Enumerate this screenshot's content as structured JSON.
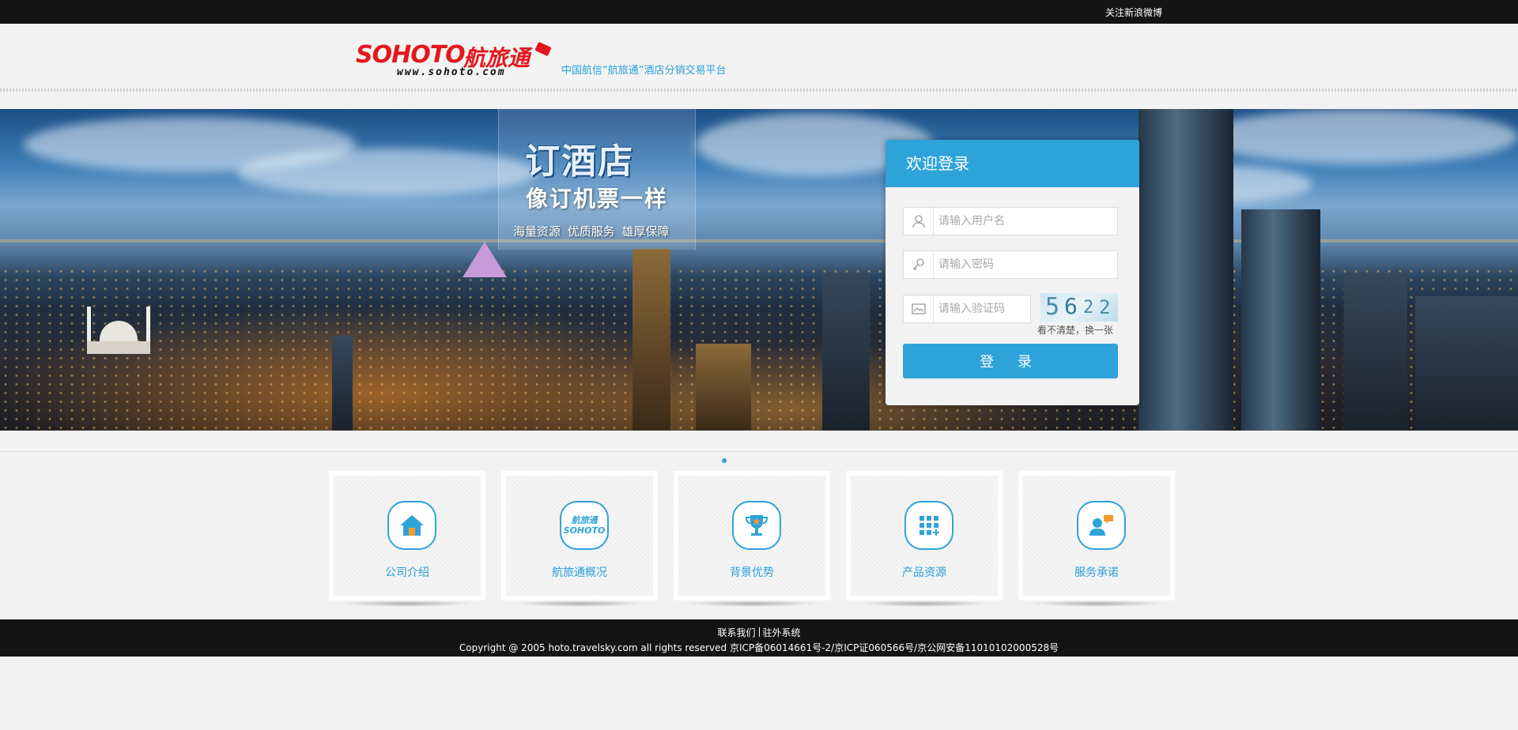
{
  "topbar": {
    "weibo_link": "关注新浪微博"
  },
  "header": {
    "logo_brand": "SOHOTO",
    "logo_brand_cn": "航旅通",
    "logo_url": "www.sohoto.com",
    "tagline": "中国航信“航旅通”酒店分销交易平台"
  },
  "banner": {
    "slogan_main": "订酒店",
    "slogan_sub": "像订机票一样",
    "slogan_features": "海量资源  优质服务  雄厚保障"
  },
  "login": {
    "title": "欢迎登录",
    "username_placeholder": "请输入用户名",
    "password_placeholder": "请输入密码",
    "captcha_placeholder": "请输入验证码",
    "captcha_chars": [
      "5",
      "6",
      "2",
      "2"
    ],
    "captcha_refresh": "看不清楚，换一张",
    "submit_label": "登 录"
  },
  "cards": [
    {
      "label": "公司介绍",
      "icon": "home-icon"
    },
    {
      "label": "航旅通概况",
      "icon": "sohoto-logo-icon",
      "icon_text_cn": "航旅通",
      "icon_text_en": "SOHOTO"
    },
    {
      "label": "背景优势",
      "icon": "trophy-icon"
    },
    {
      "label": "产品资源",
      "icon": "grid-icon"
    },
    {
      "label": "服务承诺",
      "icon": "support-chat-icon"
    }
  ],
  "footer": {
    "contact_link": "联系我们",
    "agency_link": "驻外系统",
    "copyright": "Copyright @ 2005 hoto.travelsky.com all rights reserved 京ICP备06014661号-2/京ICP证060566号/京公网安备11010102000528号"
  },
  "colors": {
    "accent": "#2ea3da",
    "brand_red": "#e3171d",
    "bar": "#141414"
  }
}
